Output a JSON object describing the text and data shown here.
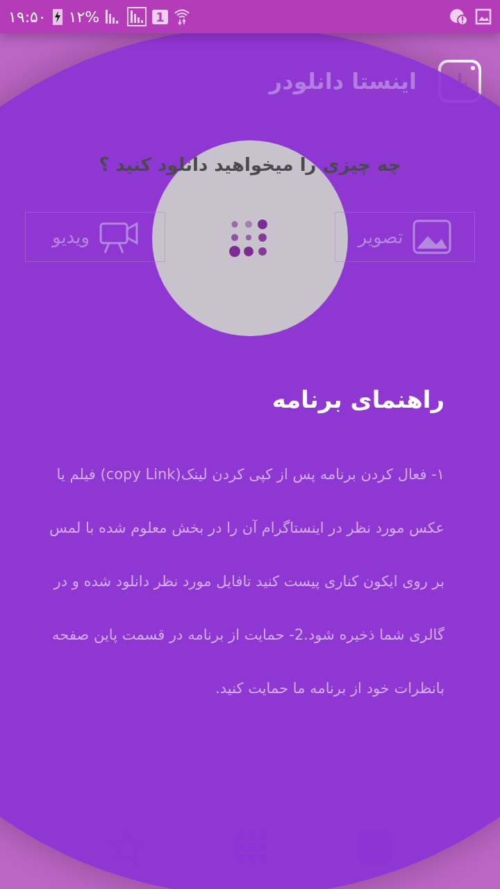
{
  "status_bar": {
    "time": "۱۹:۵۰",
    "battery": "۱۲%",
    "sim_slot": "1"
  },
  "app_bar": {
    "title": "اینستا دانلودر"
  },
  "prompt": "چه چیزی را میخواهید دانلود کنید ؟",
  "media_buttons": [
    {
      "label": "تصویر",
      "kind": "image"
    },
    {
      "label": "ویدیو",
      "kind": "video"
    }
  ],
  "guide": {
    "title": "راهنمای برنامه",
    "body": "۱- فعال کردن برنامه پس از کپی کردن لینک(copy Link) فیلم یا عکس مورد نظر در اینستاگرام آن را در بخش معلوم شده با لمس بر روی ایکون کناری پیست کنید تافایل مورد نظر دانلود شده و در گالری شما ذخیره شود.2- حمایت از برنامه در قسمت پاین صفحه بانظرات خود از برنامه ما حمایت کنید."
  }
}
